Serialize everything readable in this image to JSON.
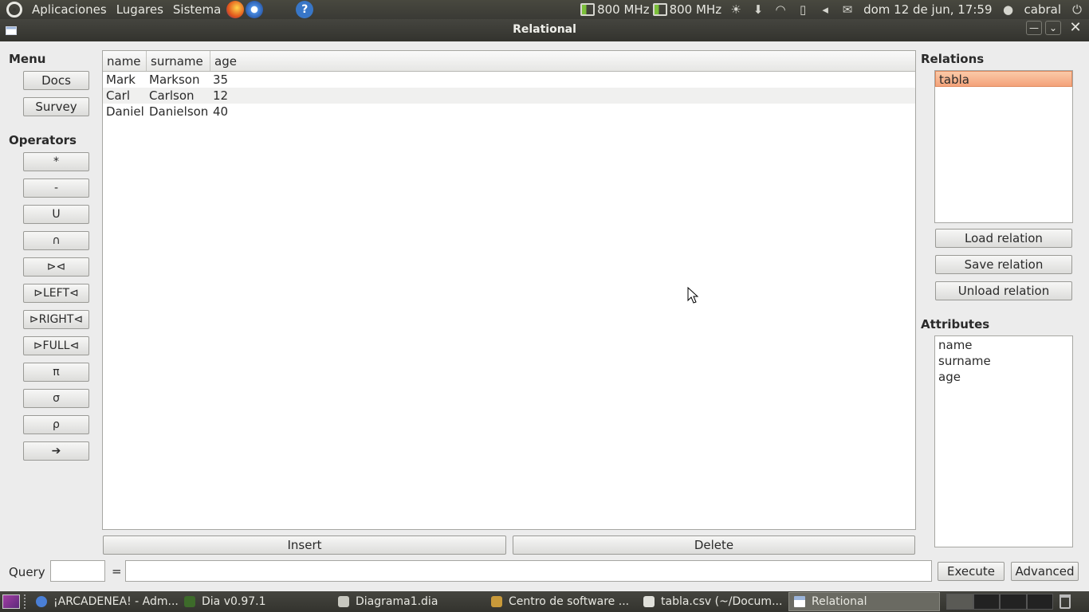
{
  "top_panel": {
    "menus": [
      "Aplicaciones",
      "Lugares",
      "Sistema"
    ],
    "cpu1": "800 MHz",
    "cpu2": "800 MHz",
    "clock": "dom 12 de jun, 17:59",
    "user": "cabral",
    "help_glyph": "?"
  },
  "window": {
    "title": "Relational",
    "min_glyph": "—",
    "max_glyph": "⌄",
    "close_glyph": "✕"
  },
  "menu": {
    "heading": "Menu",
    "docs": "Docs",
    "survey": "Survey"
  },
  "operators": {
    "heading": "Operators",
    "items": [
      "*",
      "-",
      "U",
      "∩",
      "⊳⊲",
      "⊳LEFT⊲",
      "⊳RIGHT⊲",
      "⊳FULL⊲",
      "π",
      "σ",
      "ρ",
      "➔"
    ]
  },
  "table": {
    "columns": [
      "name",
      "surname",
      "age"
    ],
    "rows": [
      [
        "Mark",
        "Markson",
        "35"
      ],
      [
        "Carl",
        "Carlson",
        "12"
      ],
      [
        "Daniel",
        "Danielson",
        "40"
      ]
    ],
    "insert": "Insert",
    "delete": "Delete"
  },
  "relations": {
    "heading": "Relations",
    "items": [
      "tabla"
    ],
    "selected": "tabla",
    "load": "Load relation",
    "save": "Save relation",
    "unload": "Unload relation"
  },
  "attributes": {
    "heading": "Attributes",
    "items": [
      "name",
      "surname",
      "age"
    ]
  },
  "query": {
    "label": "Query",
    "equals": "=",
    "result_name": "",
    "expression": "",
    "execute": "Execute",
    "advanced": "Advanced"
  },
  "taskbar": {
    "tasks": [
      "¡ARCADENEA! - Adm...",
      "Dia v0.97.1",
      "Diagrama1.dia",
      "Centro de software ...",
      "tabla.csv (~/Docum...",
      "Relational"
    ],
    "active": "Relational"
  },
  "colors": {
    "selection": "#f4a37a",
    "panel": "#3a3a35",
    "window_bg": "#ececec"
  }
}
